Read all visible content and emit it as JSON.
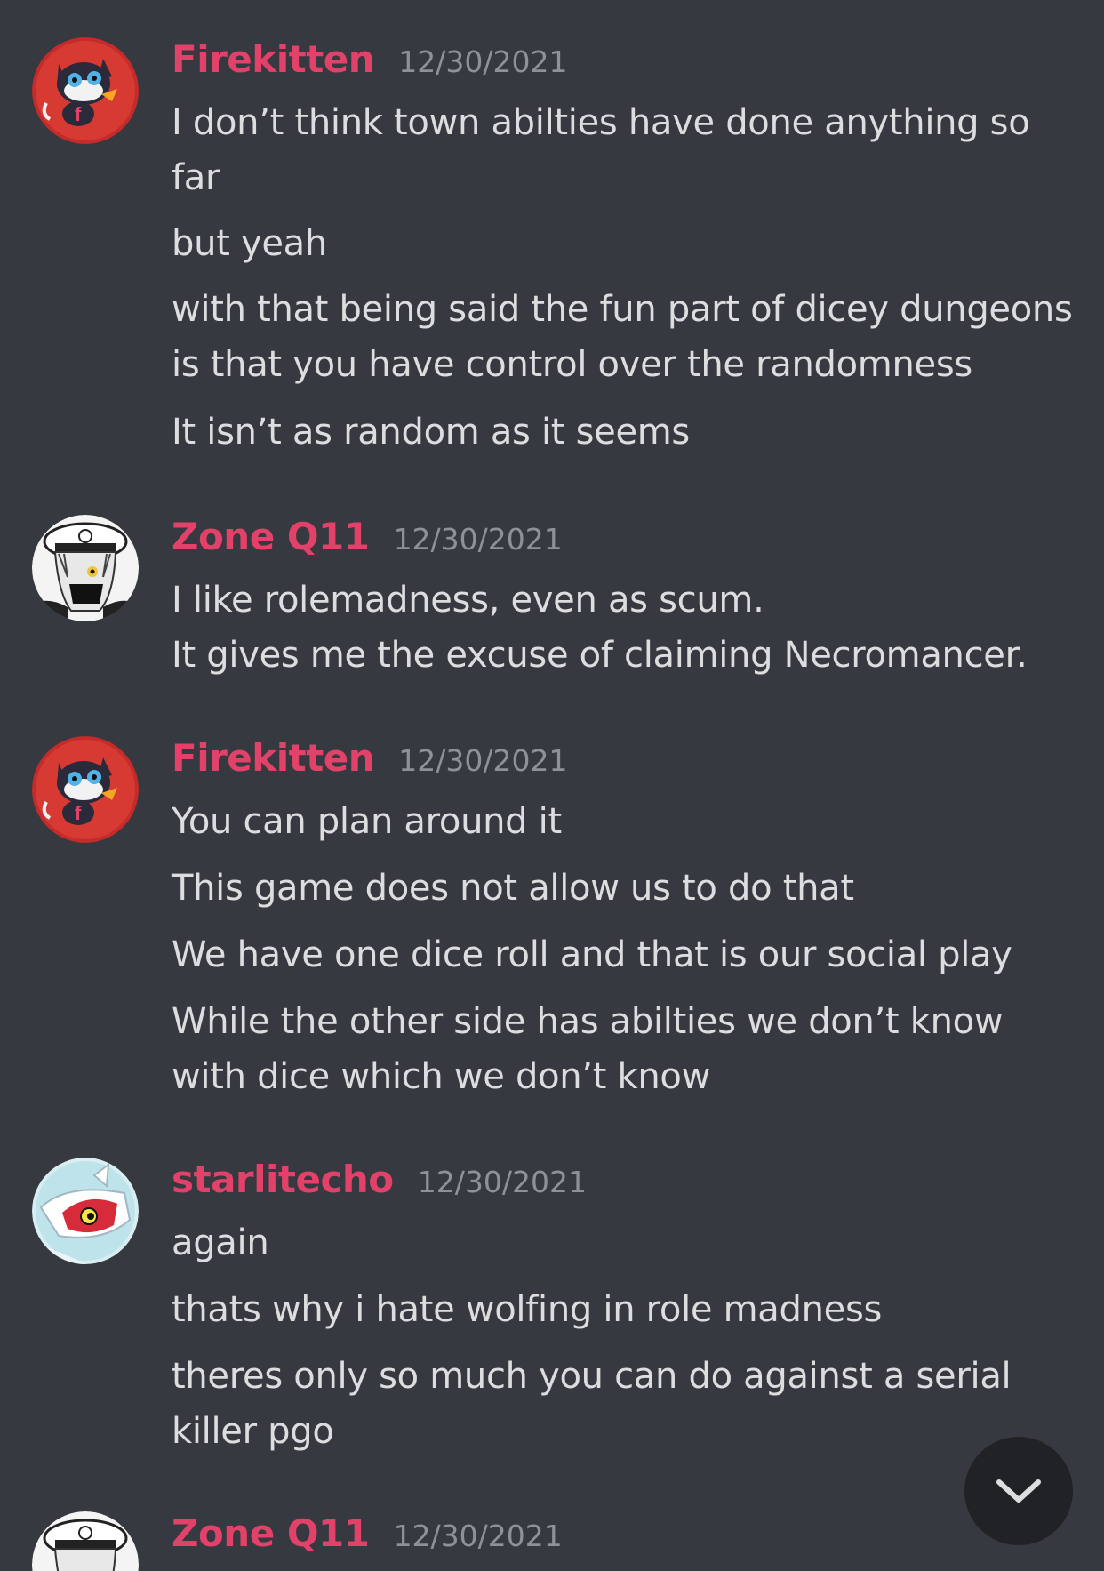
{
  "messages": [
    {
      "author": "Firekitten",
      "timestamp": "12/30/2021",
      "avatar": "cat-mascot-avatar",
      "lines": [
        "I don’t think town abilties have done anything so",
        "far",
        "but yeah",
        "with that being said the fun part of dicey dungeons",
        "is that you have control over the randomness",
        "It isn’t as random as it seems"
      ]
    },
    {
      "author": "Zone Q11",
      "timestamp": "12/30/2021",
      "avatar": "anime-officer-avatar",
      "lines": [
        "I like rolemadness, even as scum.",
        "It gives me the excuse of claiming Necromancer."
      ]
    },
    {
      "author": "Firekitten",
      "timestamp": "12/30/2021",
      "avatar": "cat-mascot-avatar",
      "lines": [
        "You can plan around it",
        "This game does not allow us to do that",
        "We have one dice roll and that is our social play",
        "While the other side has abilties we don’t know",
        "with dice which we don’t know"
      ]
    },
    {
      "author": "starlitecho",
      "timestamp": "12/30/2021",
      "avatar": "latias-avatar",
      "lines": [
        "again",
        "thats why i hate wolfing in role madness",
        "theres only so much you can do against a serial",
        "killer pgo"
      ]
    },
    {
      "author": "Zone Q11",
      "timestamp": "12/30/2021",
      "avatar": "anime-officer-avatar",
      "lines": []
    }
  ],
  "colors": {
    "background": "#36393f",
    "username": "#e2416a",
    "timestamp": "#8e9297",
    "text": "#dcddde",
    "scroll_button": "#202225"
  },
  "scroll_button_icon": "chevron-down-icon"
}
